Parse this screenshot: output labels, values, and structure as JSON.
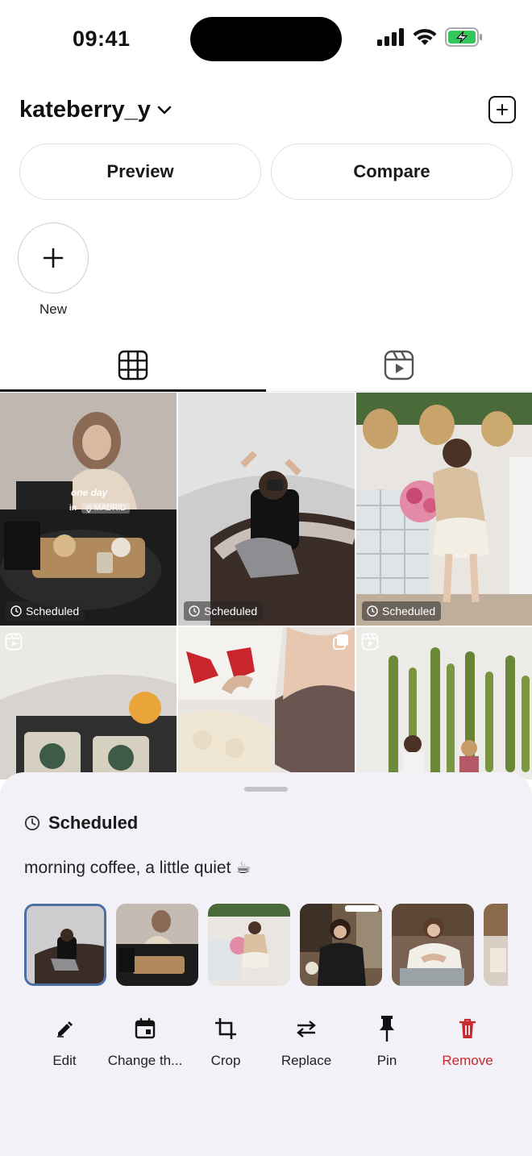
{
  "status_bar": {
    "time": "09:41"
  },
  "header": {
    "account_name": "kateberry_y"
  },
  "buttons": {
    "preview": "Preview",
    "compare": "Compare"
  },
  "story": {
    "new_label": "New"
  },
  "grid": {
    "badge_label": "Scheduled",
    "cells": [
      {
        "overlay_line1": "one day",
        "overlay_line2": "in",
        "overlay_place": "MADRID"
      }
    ]
  },
  "sheet": {
    "status": "Scheduled",
    "caption": "morning coffee, a little quiet ☕",
    "actions": {
      "edit": "Edit",
      "change": "Change th...",
      "crop": "Crop",
      "replace": "Replace",
      "pin": "Pin",
      "remove": "Remove"
    }
  },
  "colors": {
    "accent_selected": "#4a6fa5",
    "danger": "#c8292f",
    "sheet_bg": "#f1f1f7"
  }
}
